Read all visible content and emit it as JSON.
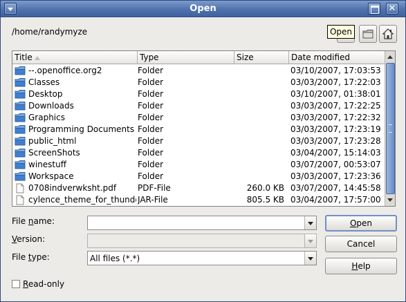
{
  "window": {
    "title": "Open"
  },
  "titlebar_icons": [
    "menu-arrow-icon",
    "maximize-icon",
    "close-icon"
  ],
  "close_glyph": "✕",
  "path": "/home/randymyze",
  "tooltip": "Open",
  "columns": {
    "name": "Title",
    "type": "Type",
    "size": "Size",
    "date": "Date modified"
  },
  "files": [
    {
      "name": "--.openoffice.org2",
      "type": "Folder",
      "size": "",
      "date": "03/10/2007, 17:03:53",
      "kind": "folder"
    },
    {
      "name": "Classes",
      "type": "Folder",
      "size": "",
      "date": "03/03/2007, 17:22:03",
      "kind": "folder"
    },
    {
      "name": "Desktop",
      "type": "Folder",
      "size": "",
      "date": "03/10/2007, 01:38:01",
      "kind": "folder"
    },
    {
      "name": "Downloads",
      "type": "Folder",
      "size": "",
      "date": "03/03/2007, 17:22:25",
      "kind": "folder"
    },
    {
      "name": "Graphics",
      "type": "Folder",
      "size": "",
      "date": "03/03/2007, 17:22:32",
      "kind": "folder"
    },
    {
      "name": "Programming Documents",
      "type": "Folder",
      "size": "",
      "date": "03/03/2007, 17:23:19",
      "kind": "folder"
    },
    {
      "name": "public_html",
      "type": "Folder",
      "size": "",
      "date": "03/03/2007, 17:23:28",
      "kind": "folder"
    },
    {
      "name": "ScreenShots",
      "type": "Folder",
      "size": "",
      "date": "03/04/2007, 15:14:03",
      "kind": "folder"
    },
    {
      "name": "winestuff",
      "type": "Folder",
      "size": "",
      "date": "03/07/2007, 00:53:07",
      "kind": "folder"
    },
    {
      "name": "Workspace",
      "type": "Folder",
      "size": "",
      "date": "03/03/2007, 17:23:36",
      "kind": "folder"
    },
    {
      "name": "0708indverwksht.pdf",
      "type": "PDF-File",
      "size": "260.0 KB",
      "date": "03/07/2007, 14:45:58",
      "kind": "file"
    },
    {
      "name": "cylence_theme_for_thunde",
      "type": "JAR-File",
      "size": "805.5 KB",
      "date": "03/04/2007, 17:57:00",
      "kind": "file"
    }
  ],
  "form": {
    "file_name": {
      "label_pre": "File ",
      "label_key": "n",
      "label_post": "ame:",
      "value": ""
    },
    "version": {
      "label_pre": "",
      "label_key": "V",
      "label_post": "ersion:",
      "value": ""
    },
    "file_type": {
      "label_pre": "File ",
      "label_key": "t",
      "label_post": "ype:",
      "value": "All files (*.*)"
    },
    "read_only": {
      "label_pre": "",
      "label_key": "R",
      "label_post": "ead-only",
      "checked": false
    }
  },
  "buttons": {
    "open": {
      "pre": "",
      "key": "O",
      "post": "pen"
    },
    "cancel": "Cancel",
    "help": {
      "pre": "",
      "key": "H",
      "post": "elp"
    }
  },
  "colors": {
    "titlebar": "#4f72ad",
    "folder": "#3f7fd0",
    "dialog_bg": "#ecebe8"
  }
}
